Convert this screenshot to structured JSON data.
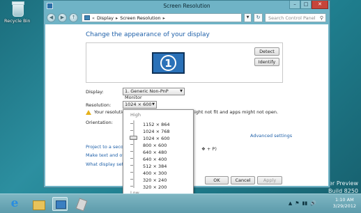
{
  "desktop": {
    "recycle_bin_label": "Recycle Bin",
    "watermark_line1": "er Preview",
    "watermark_line2": "Build 8250"
  },
  "window": {
    "title": "Screen Resolution",
    "minimize": "–",
    "maximize": "□",
    "close": "✕"
  },
  "nav": {
    "back": "◀",
    "forward": "▶",
    "up": "↑",
    "breadcrumb": [
      "«",
      "Display",
      "▸",
      "Screen Resolution",
      "▸"
    ],
    "refresh": "↻",
    "search_placeholder": "Search Control Panel",
    "search_icon": "⚲"
  },
  "content": {
    "heading": "Change the appearance of your display",
    "monitor_number": "1",
    "detect_label": "Detect",
    "identify_label": "Identify",
    "display_label": "Display:",
    "display_value": "1. Generic Non-PnP Monitor",
    "resolution_label": "Resolution:",
    "resolution_value": "1024 × 600",
    "warning_text": "Your resolution",
    "warning_text_tail": "ight not fit and apps might not open.",
    "orientation_label": "Orientation:",
    "advanced_settings": "Advanced settings",
    "link_project": "Project to a second",
    "link_text": "Make text and other",
    "link_display": "What display setting",
    "win_key_hint": "+ P)",
    "ok_label": "OK",
    "cancel_label": "Cancel",
    "apply_label": "Apply"
  },
  "resolution_dropdown": {
    "high_label": "High",
    "low_label": "Low",
    "options": [
      "1152 × 864",
      "1024 × 768",
      "1024 × 600",
      "800 × 600",
      "640 × 480",
      "640 × 400",
      "512 × 384",
      "400 × 300",
      "320 × 240",
      "320 × 200"
    ],
    "selected_index": 2
  },
  "taskbar": {
    "ie_icon": "e",
    "tray_icons": [
      "▲",
      "⚑",
      "▮▮",
      "🔊"
    ],
    "time": "1:10 AM",
    "date": "3/29/2012"
  },
  "colors": {
    "desktop": "#2c8fa0",
    "link": "#1d5fa8",
    "close_button": "#c7453a",
    "warning": "#e5b11b"
  }
}
